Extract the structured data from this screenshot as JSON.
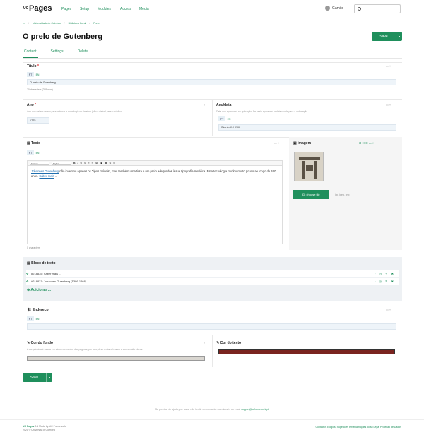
{
  "brand": {
    "uc": "UC",
    "name": "Pages"
  },
  "nav": [
    "Pages",
    "Setup",
    "Modules",
    "Access",
    "Media"
  ],
  "user": {
    "name": "Gamito"
  },
  "breadcrumb": [
    "Universidade de Coimbra",
    "Biblioteca Geral",
    "Prelo"
  ],
  "page": {
    "title": "O prelo de Gutenberg",
    "save": "Save"
  },
  "tabs": [
    "Content",
    "Settings",
    "Delete"
  ],
  "titulo": {
    "label": "Título",
    "required": "*",
    "langs": [
      "PT",
      "EN"
    ],
    "value": "O prelo de Gutenberg",
    "count": "20 characters (255 max)"
  },
  "ano": {
    "label": "Ano",
    "required": "*",
    "help": "Ano que vai ser usado para ordenar a cronologia no timeline (não é visível para o público)",
    "value": "1775"
  },
  "anodata": {
    "label": "Ano/data",
    "help": "Data que aparecerá na aplicação. Se vazio aparecerá a data usada para a ordenação.",
    "langs": [
      "PT",
      "EN"
    ],
    "value": "Século XV-XVIII"
  },
  "texto": {
    "label": "Texto",
    "langs": [
      "PT",
      "EN"
    ],
    "toolbar_format": "Format",
    "toolbar_styles": "Styles",
    "chars": "0 characters",
    "body_link1": "Johannes Gutenberg",
    "body_main": " não inventou apenas os “tipos móveis”, mas também uma tinta e um prelo adequados à sua tipografia metálica. Esta tecnologia mudou muito pouco ao longo de 400 anos. ",
    "body_link2": "Saber mais",
    "body_end": " ..."
  },
  "imagem": {
    "label": "Imagem",
    "choose": "ID: choose file",
    "types": "jpg, jpeg, png"
  },
  "bloco": {
    "label": "Bloco de texto",
    "rows": [
      "#218835: Saber mais ...",
      "#218837: Johannes Gutenberg (1396-1468) ..."
    ],
    "add": "Adicionar ..."
  },
  "endereco": {
    "label": "Endereço",
    "langs": [
      "PT",
      "EN"
    ]
  },
  "corfundo": {
    "label": "Cor do fundo",
    "help": "A cor primária é usada em vários elementos das páginas, por isso, deve evitar-o branco e cores muito claras.",
    "color": "#d9d6d0"
  },
  "cortexto": {
    "label": "Cor do texto",
    "color": "#7a2420"
  },
  "footnote": {
    "pre": "Se precisar de ajuda, por favor, não hesite em contactar-nos através do email ",
    "email": "support@ucframework.pt"
  },
  "footer": {
    "brand": "UC Pages",
    "ver": " 0.1 Made by UC Framework",
    "copy": "2021 © University of Coimbra",
    "links": "Contactos Elogios, Sugestões e Reclamações Aviso Legal Proteção de Dados"
  }
}
